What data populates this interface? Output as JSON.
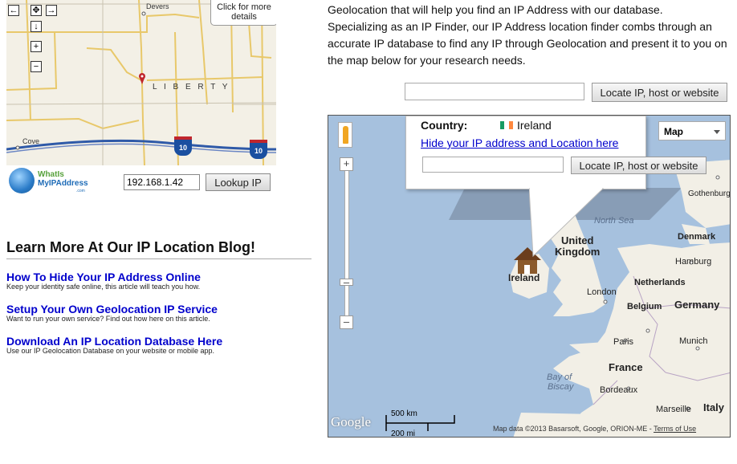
{
  "mini_map": {
    "callout": "Click for more details",
    "places": {
      "devers": "Devers",
      "liberty": "L I B E R T Y",
      "cove": "Cove"
    },
    "highway_shields": [
      "10",
      "10"
    ],
    "nav": {
      "pan": "✥",
      "right": "→",
      "down": "↓",
      "zoom_in": "+",
      "zoom_out": "−"
    }
  },
  "logo": {
    "line1": "WhatIs",
    "line2": "MyIPAddress",
    "line3": ".com"
  },
  "lookup": {
    "ip_value": "192.168.1.42",
    "button": "Lookup IP"
  },
  "blog": {
    "heading": "Learn More At Our IP Location Blog!",
    "posts": [
      {
        "title": "How To Hide Your IP Address Online",
        "desc": "Keep your identity safe online, this article will teach you how."
      },
      {
        "title": "Setup Your Own Geolocation IP Service",
        "desc": "Want to run your own service? Find out how here on this article."
      },
      {
        "title": "Download An IP Location Database Here",
        "desc": "Use our IP Geolocation Database on your website or mobile app."
      }
    ]
  },
  "intro": {
    "line1": "Geolocation that will help you find an IP Address with our database.",
    "rest": "Specializing as an IP Finder, our IP Address location finder combs through an accurate IP database to find any IP through Geolocation and present it to you on the map below for your research needs."
  },
  "locate": {
    "placeholder": "",
    "button": "Locate IP, host or website"
  },
  "info_window": {
    "country_label": "Country:",
    "country_value": "Ireland",
    "hide_link": "Hide your IP address and Location here",
    "button": "Locate IP, host or website"
  },
  "map_type": {
    "selected": "Map"
  },
  "map_labels": {
    "north_sea": "North Sea",
    "gothenburg": "Gothenburg",
    "denmark": "Denmark",
    "united_kingdom_1": "United",
    "united_kingdom_2": "Kingdom",
    "ireland": "Ireland",
    "hamburg": "Hamburg",
    "netherlands": "Netherlands",
    "london": "London",
    "germany": "Germany",
    "belgium": "Belgium",
    "paris": "Paris",
    "munich": "Munich",
    "france": "France",
    "bay_of_biscay_1": "Bay of",
    "bay_of_biscay_2": "Biscay",
    "bordeaux": "Bordeaux",
    "marseille": "Marseille",
    "italy": "Italy"
  },
  "scale": {
    "top": "500 km",
    "bottom": "200 mi"
  },
  "google_logo": "Google",
  "attribution": {
    "text": "Map data ©2013 Basarsoft, Google, ORION-ME - ",
    "terms": "Terms of Use"
  },
  "colors": {
    "water": "#a6c1de",
    "land": "#f2efe6",
    "link": "#0000cc",
    "pin": "#c0262d"
  }
}
